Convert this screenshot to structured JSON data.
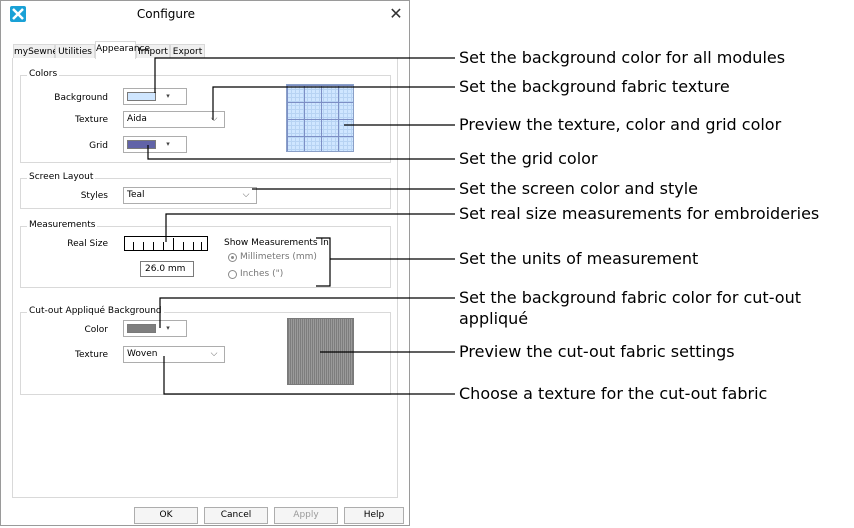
{
  "window": {
    "title": "Configure",
    "close_glyph": "✕"
  },
  "tabs": [
    {
      "label": "mySewnet"
    },
    {
      "label": "Utilities"
    },
    {
      "label": "Appearance"
    },
    {
      "label": "Import"
    },
    {
      "label": "Export"
    }
  ],
  "active_tab": "Appearance",
  "colors_group": {
    "title": "Colors",
    "background_label": "Background",
    "background_color": "#cfe6ff",
    "texture_label": "Texture",
    "texture_value": "Aida",
    "grid_label": "Grid",
    "grid_color": "#6163a8"
  },
  "screen_layout_group": {
    "title": "Screen Layout",
    "styles_label": "Styles",
    "styles_value": "Teal"
  },
  "measurements_group": {
    "title": "Measurements",
    "real_size_label": "Real Size",
    "real_size_value": "26.0 mm",
    "show_in_label": "Show Measurements In",
    "option_mm": "Millimeters (mm)",
    "option_in": "Inches (\")",
    "selected_unit": "mm"
  },
  "cutout_group": {
    "title": "Cut-out Appliqué Background",
    "color_label": "Color",
    "color_value": "#7f7f7f",
    "texture_label": "Texture",
    "texture_value": "Woven"
  },
  "buttons": {
    "ok": "OK",
    "cancel": "Cancel",
    "apply": "Apply",
    "help": "Help"
  },
  "icons": {
    "app": "app-logo-icon",
    "dropdown_arrow": "▾",
    "chevron": "⌵"
  },
  "callouts": [
    "Set the background color for all modules",
    "Set the background fabric texture",
    "Preview the texture, color and grid color",
    "Set the grid color",
    "Set the screen color and style",
    "Set real size measurements for embroideries",
    "Set the units of measurement",
    "Set the background fabric color for cut-out",
    "appliqué",
    "Preview the cut-out fabric settings",
    "Choose a texture for the cut-out fabric"
  ]
}
